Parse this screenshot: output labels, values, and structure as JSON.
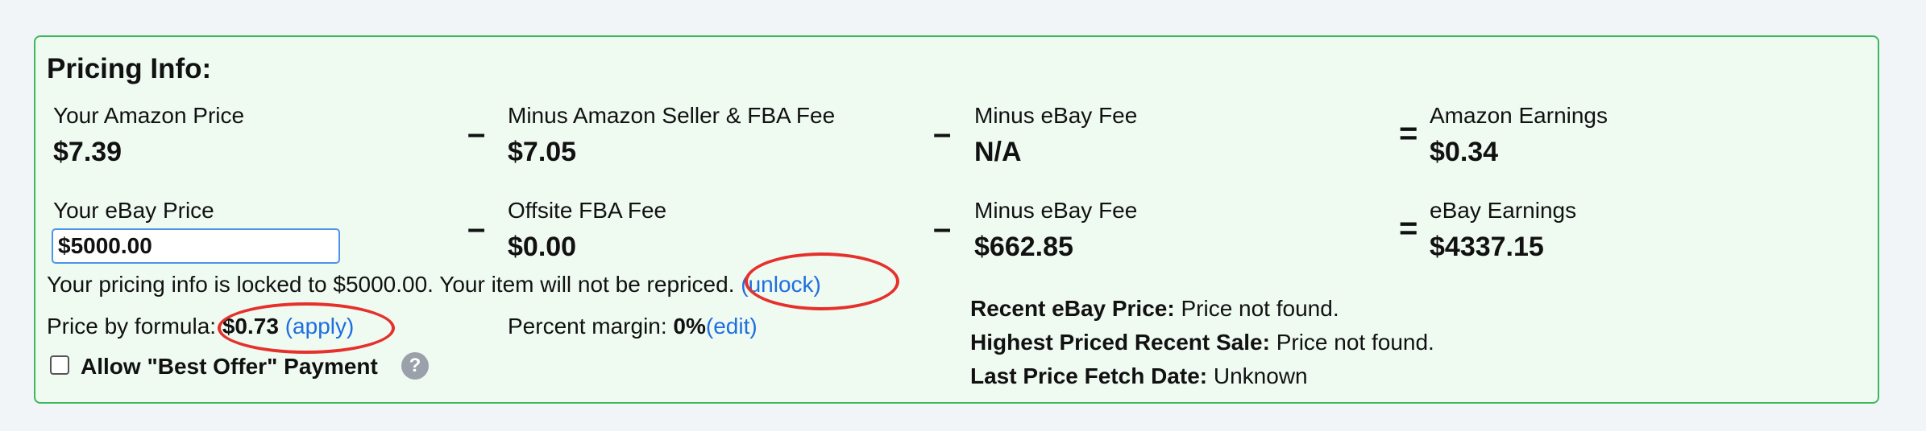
{
  "title": "Pricing Info:",
  "row1": {
    "amazon_price_label": "Your Amazon Price",
    "amazon_price_value": "$7.39",
    "op1": "–",
    "seller_fee_label": "Minus Amazon Seller & FBA Fee",
    "seller_fee_value": "$7.05",
    "op2": "–",
    "ebay_fee_label": "Minus eBay Fee",
    "ebay_fee_value": "N/A",
    "op3": "=",
    "earnings_label": "Amazon Earnings",
    "earnings_value": "$0.34"
  },
  "row2": {
    "ebay_price_label": "Your eBay Price",
    "ebay_price_input": "$5000.00",
    "op1": "–",
    "offsite_fee_label": "Offsite FBA Fee",
    "offsite_fee_value": "$0.00",
    "op2": "–",
    "ebay_fee_label": "Minus eBay Fee",
    "ebay_fee_value": "$662.85",
    "op3": "=",
    "earnings_label": "eBay Earnings",
    "earnings_value": "$4337.15"
  },
  "lock_notice": {
    "text": "Your pricing info is locked to $5000.00. Your item will not be repriced.",
    "unlock_link": "(unlock)"
  },
  "formula": {
    "label": "Price by formula:",
    "value": "$0.73",
    "apply_link": "(apply)"
  },
  "margin": {
    "label": "Percent margin:",
    "value": "0%",
    "edit_link": "(edit)"
  },
  "best_offer": {
    "label": "Allow \"Best Offer\" Payment",
    "checked": false,
    "help": "?"
  },
  "recent": {
    "recent_label": "Recent eBay Price:",
    "recent_value": "Price not found.",
    "highest_label": "Highest Priced Recent Sale:",
    "highest_value": "Price not found.",
    "fetch_label": "Last Price Fetch Date:",
    "fetch_value": "Unknown"
  },
  "colors": {
    "panel_bg": "#effaf1",
    "panel_border": "#3cb85a",
    "link": "#1f6ee0",
    "annotation": "#e5302c"
  },
  "icons": [
    "help-icon",
    "checkbox"
  ]
}
